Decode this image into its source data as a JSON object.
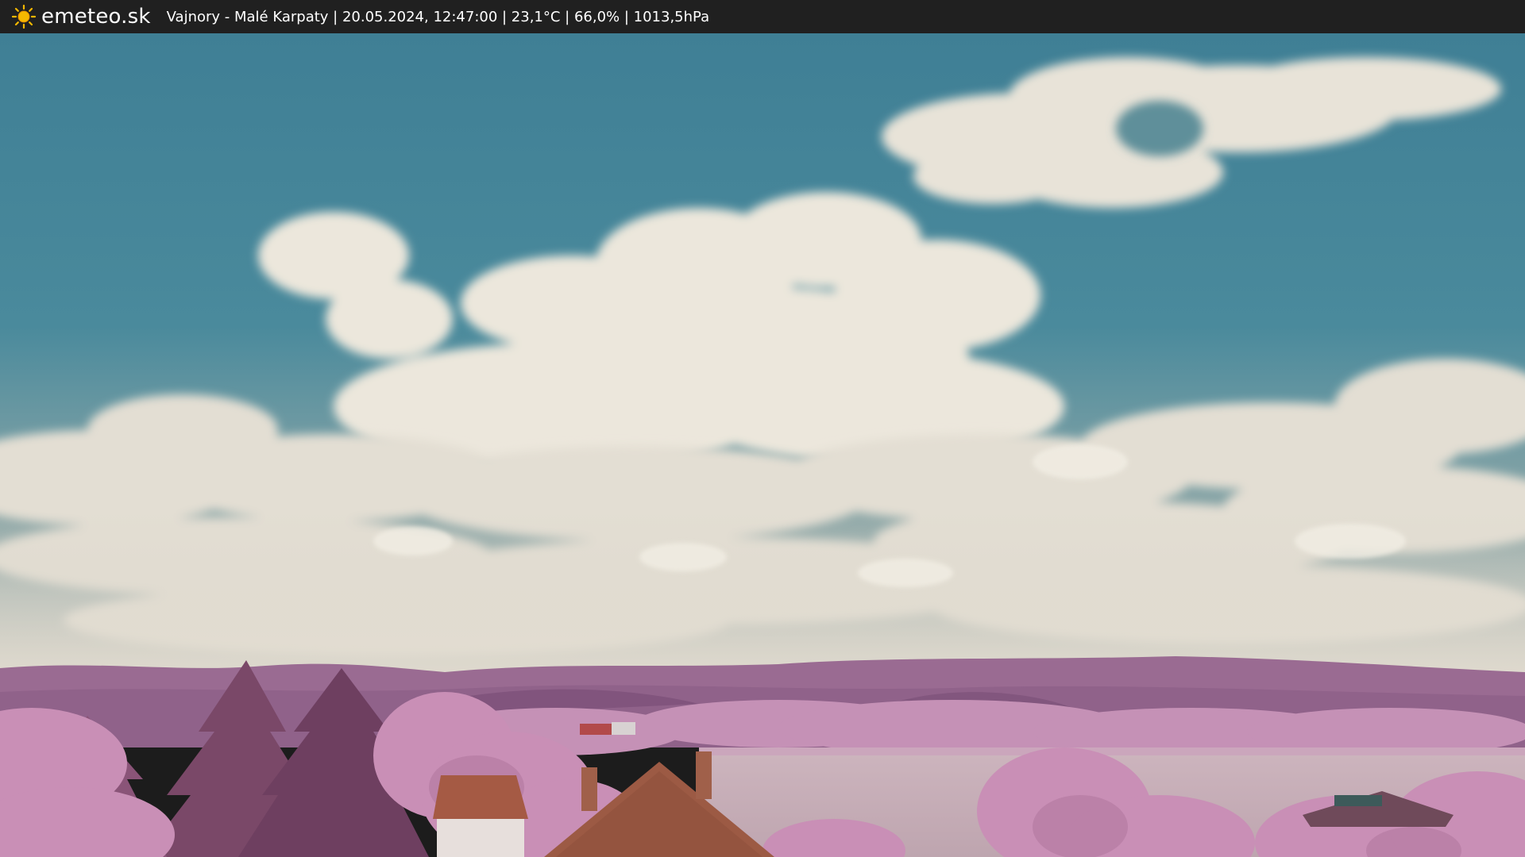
{
  "header": {
    "brand_name": "emeteo.sk",
    "logo_icon": "sun-icon",
    "station_info": "Vajnory - Malé Karpaty | 20.05.2024, 12:47:00 | 23,1°C | 66,0% | 1013,5hPa"
  },
  "colors": {
    "bar_background": "#202020",
    "bar_text": "#ffffff",
    "sun_icon": "#f5b800",
    "sky": "#4a8a9e",
    "cloud": "#e2ddd3",
    "hills": "#9a6b92",
    "foliage": "#c98fb6",
    "roof": "#9c5a44"
  },
  "webcam": {
    "description_icon": "webcam-image"
  }
}
